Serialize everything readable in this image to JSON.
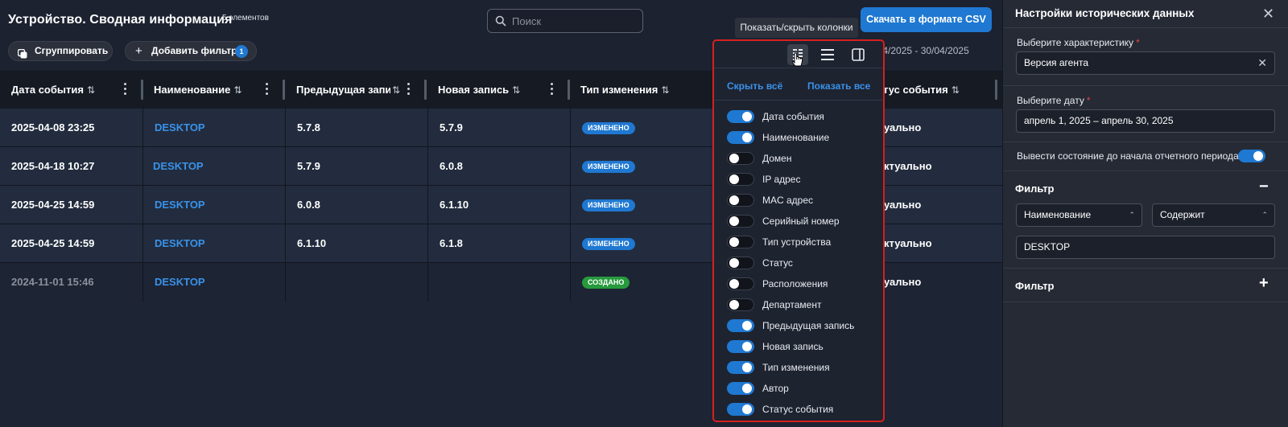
{
  "header": {
    "title": "Устройство. Сводная информация",
    "count": "5 элементов",
    "search_placeholder": "Поиск",
    "csv_button": "Скачать в формате CSV",
    "tooltip": "Показать/скрыть колонки",
    "group_button": "Сгруппировать",
    "add_filter_button": "Добавить фильтр",
    "filter_count": "1",
    "date_range": "01/04/2025 - 30/04/2025"
  },
  "table": {
    "sort_icon": "⇅",
    "columns": [
      "Дата события",
      "Наименование",
      "Предыдущая запи",
      "Новая запись",
      "Тип изменения",
      "тус события"
    ],
    "rows": [
      {
        "date": "2025-04-08 23:25",
        "name": "DESKTOP",
        "prev": "5.7.8",
        "new": "5.7.9",
        "type": "ИЗМЕНЕНО",
        "status": "уально"
      },
      {
        "date": "2025-04-18 10:27",
        "name": "DESKTOP",
        "prev": "5.7.9",
        "new": "6.0.8",
        "type": "ИЗМЕНЕНО",
        "status": "ктуально"
      },
      {
        "date": "2025-04-25 14:59",
        "name": "DESKTOP",
        "prev": "6.0.8",
        "new": "6.1.10",
        "type": "ИЗМЕНЕНО",
        "status": "уально"
      },
      {
        "date": "2025-04-25 14:59",
        "name": "DESKTOP",
        "prev": "6.1.10",
        "new": "6.1.8",
        "type": "ИЗМЕНЕНО",
        "status": "ктуально"
      },
      {
        "date": "2024-11-01 15:46",
        "name": "DESKTOP",
        "prev": "",
        "new": "",
        "type": "СОЗДАНО",
        "status": "уально"
      }
    ]
  },
  "column_picker": {
    "hide_all": "Скрыть всё",
    "show_all": "Показать все",
    "items": [
      {
        "label": "Дата события",
        "on": true
      },
      {
        "label": "Наименование",
        "on": true
      },
      {
        "label": "Домен",
        "on": false
      },
      {
        "label": "IP адрес",
        "on": false
      },
      {
        "label": "MAC адрес",
        "on": false
      },
      {
        "label": "Серийный номер",
        "on": false
      },
      {
        "label": "Тип устройства",
        "on": false
      },
      {
        "label": "Статус",
        "on": false
      },
      {
        "label": "Расположения",
        "on": false
      },
      {
        "label": "Департамент",
        "on": false
      },
      {
        "label": "Предыдущая запись",
        "on": true
      },
      {
        "label": "Новая запись",
        "on": true
      },
      {
        "label": "Тип изменения",
        "on": true
      },
      {
        "label": "Автор",
        "on": true
      },
      {
        "label": "Статус события",
        "on": true
      }
    ]
  },
  "settings": {
    "title": "Настройки исторических данных",
    "characteristic_label": "Выберите характеристику",
    "characteristic_value": "Версия агента",
    "date_label": "Выберите дату",
    "date_value": "апрель 1, 2025 – апрель 30, 2025",
    "show_state_label": "Вывести состояние до начала отчетного периода",
    "filter1_title": "Фильтр",
    "filter1_field": "Наименование",
    "filter1_op": "Содержит",
    "filter1_value": "DESKTOP",
    "filter2_title": "Фильтр",
    "required_mark": "*"
  },
  "colors": {
    "accent": "#1f78d1",
    "highlight": "#d6201e",
    "created": "#279a3d"
  }
}
